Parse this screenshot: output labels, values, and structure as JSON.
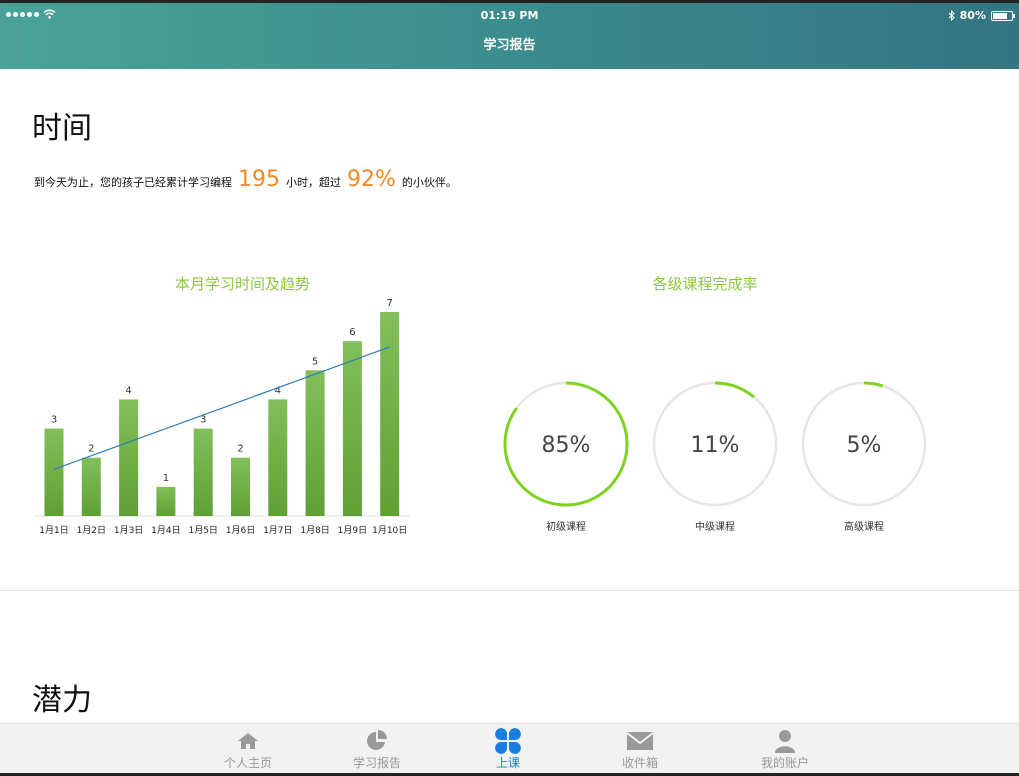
{
  "status_bar": {
    "time": "01:19 PM",
    "battery": "80%",
    "battery_level": 0.8,
    "signal_icon": "signal-dots-icon",
    "wifi_icon": "wifi-icon",
    "bluetooth_icon": "bluetooth-icon"
  },
  "nav": {
    "title": "学习报告"
  },
  "time_section": {
    "title": "时间",
    "summary_prefix": "到今天为止，您的孩子已经累计学习编程",
    "hours": "195",
    "summary_mid": "小时，超过",
    "percent": "92%",
    "summary_suffix": "的小伙伴。"
  },
  "potential_section": {
    "title": "潜力"
  },
  "accent_color": "#8dc63f",
  "highlight_color": "#f08a24",
  "chart_data": [
    {
      "type": "bar",
      "title": "本月学习时间及趋势",
      "categories": [
        "1月1日",
        "1月2日",
        "1月3日",
        "1月4日",
        "1月5日",
        "1月6日",
        "1月7日",
        "1月8日",
        "1月9日",
        "1月10日"
      ],
      "values": [
        3,
        2,
        4,
        1,
        3,
        2,
        4,
        5,
        6,
        7
      ],
      "trendline": {
        "start": 1.6,
        "end": 5.8
      },
      "ylim": [
        0,
        7
      ],
      "grid": false,
      "bar_color": "#6aab3c",
      "trend_color": "#2f7bbf"
    },
    {
      "type": "pie",
      "title": "各级课程完成率",
      "categories": [
        "初级课程",
        "中级课程",
        "高级课程"
      ],
      "values": [
        85,
        11,
        5
      ],
      "labels": [
        "85%",
        "11%",
        "5%"
      ],
      "ring_color": "#7ed321",
      "track_color": "#e6e6e6"
    }
  ],
  "tabbar": {
    "items": [
      {
        "label": "个人主页",
        "icon": "home-icon",
        "active": false
      },
      {
        "label": "学习报告",
        "icon": "pie-chart-icon",
        "active": false
      },
      {
        "label": "上课",
        "icon": "clover-icon",
        "active": true
      },
      {
        "label": "收件箱",
        "icon": "mail-icon",
        "active": false
      },
      {
        "label": "我的账户",
        "icon": "user-icon",
        "active": false
      }
    ],
    "active_color": "#1a7de0"
  }
}
